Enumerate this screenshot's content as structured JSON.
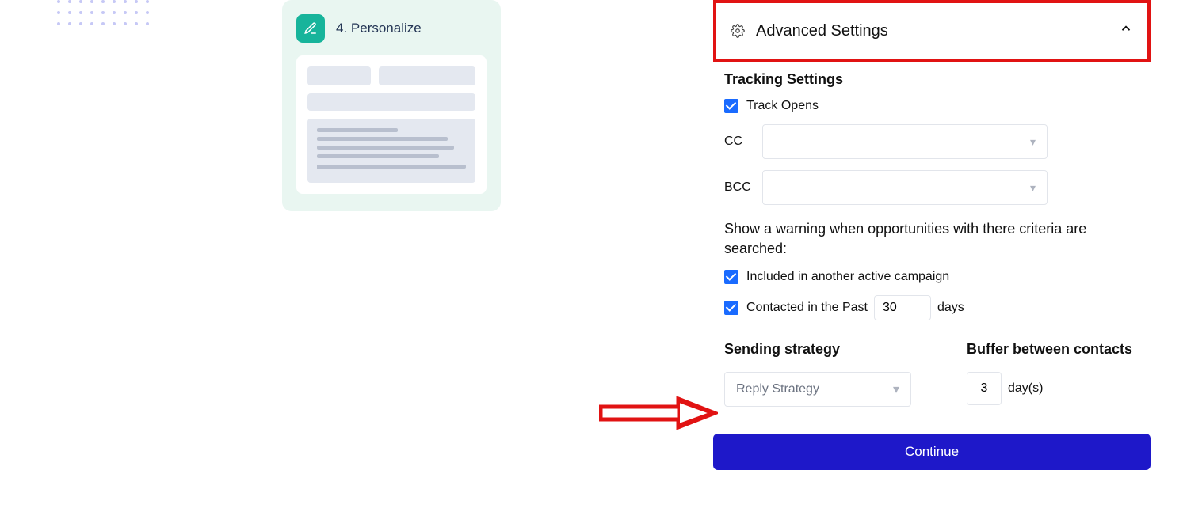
{
  "personalize_card": {
    "step_label": "4. Personalize",
    "icon": "edit-icon"
  },
  "advanced": {
    "header": "Advanced Settings",
    "tracking": {
      "title": "Tracking Settings",
      "track_opens_label": "Track Opens",
      "track_opens_checked": true,
      "cc_label": "CC",
      "cc_value": "",
      "bcc_label": "BCC",
      "bcc_value": ""
    },
    "warning": {
      "text": "Show a warning when opportunities with there criteria are searched:",
      "included_campaign_label": "Included in another active campaign",
      "included_campaign_checked": true,
      "contacted_prefix": "Contacted in the Past",
      "contacted_days_value": "30",
      "contacted_suffix": "days",
      "contacted_checked": true
    },
    "sending_strategy": {
      "title": "Sending strategy",
      "selected": "Reply Strategy"
    },
    "buffer": {
      "title": "Buffer between contacts",
      "value": "3",
      "unit": "day(s)"
    },
    "continue_label": "Continue"
  },
  "colors": {
    "annotation_red": "#e11313",
    "primary_button": "#1e18c9",
    "checkbox_blue": "#1a6bff",
    "teal_icon": "#17b49b"
  }
}
